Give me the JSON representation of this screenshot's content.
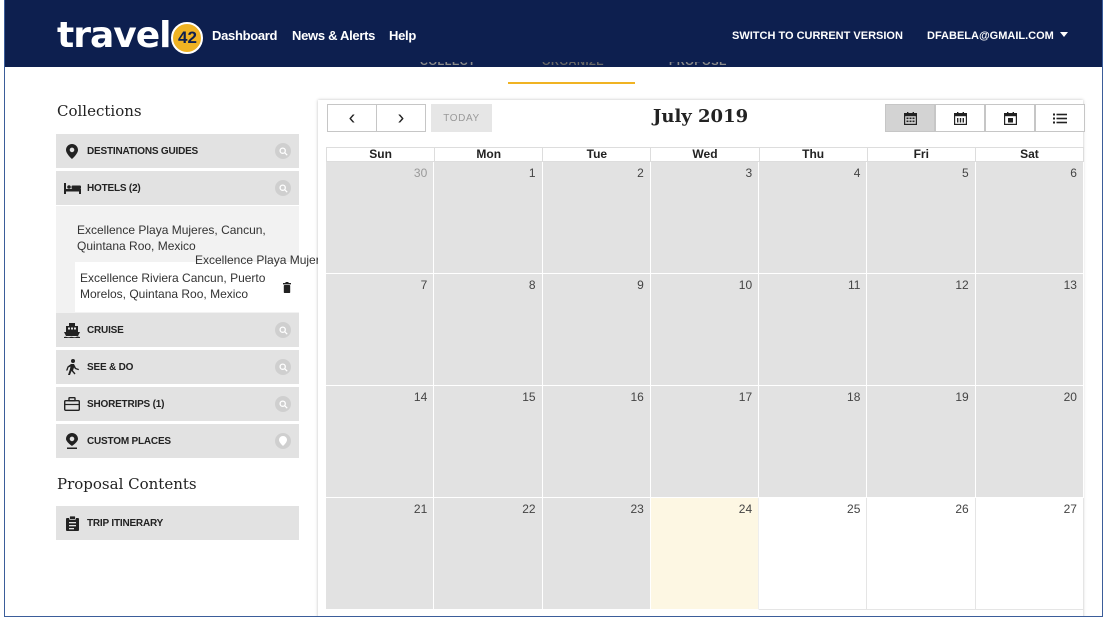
{
  "header": {
    "logo_text": "travel",
    "logo_badge": "42",
    "nav": [
      {
        "label": "Dashboard"
      },
      {
        "label": "News & Alerts"
      },
      {
        "label": "Help"
      }
    ],
    "switch_label": "SWITCH TO CURRENT VERSION",
    "user_email": "DFABELA@GMAIL.COM"
  },
  "steps": [
    {
      "label": "COLLECT"
    },
    {
      "label": "ORGANIZE",
      "active": true
    },
    {
      "label": "PROPOSE"
    }
  ],
  "sidebar": {
    "collections_title": "Collections",
    "items": [
      {
        "label": "DESTINATIONS GUIDES",
        "icon": "map-pin-icon"
      },
      {
        "label": "HOTELS (2)",
        "icon": "bed-icon"
      },
      {
        "label": "CRUISE",
        "icon": "ship-icon"
      },
      {
        "label": "SEE & DO",
        "icon": "walking-person-icon"
      },
      {
        "label": "SHORETRIPS (1)",
        "icon": "suitcase-icon"
      },
      {
        "label": "CUSTOM PLACES",
        "icon": "map-pin-icon"
      }
    ],
    "hotels": [
      {
        "name": "Excellence Playa Mujeres, Cancun, Quintana Roo, Mexico"
      },
      {
        "name": "Excellence Riviera Cancun, Puerto Morelos, Quintana Roo, Mexico"
      }
    ],
    "drag_tooltip": "Excellence Playa Mujeres, Cancun, Quintana Roo, Mexico",
    "proposal_title": "Proposal Contents",
    "proposal_items": [
      {
        "label": "TRIP ITINERARY",
        "icon": "clipboard-icon"
      }
    ]
  },
  "calendar": {
    "title": "July 2019",
    "prev": "‹",
    "next": "›",
    "today_label": "TODAY",
    "views": [
      "month-view-icon",
      "week-view-icon",
      "day-view-icon",
      "list-view-icon"
    ],
    "weekdays": [
      "Sun",
      "Mon",
      "Tue",
      "Wed",
      "Thu",
      "Fri",
      "Sat"
    ],
    "weeks": [
      [
        "30",
        "1",
        "2",
        "3",
        "4",
        "5",
        "6"
      ],
      [
        "7",
        "8",
        "9",
        "10",
        "11",
        "12",
        "13"
      ],
      [
        "14",
        "15",
        "16",
        "17",
        "18",
        "19",
        "20"
      ],
      [
        "21",
        "22",
        "23",
        "24",
        "25",
        "26",
        "27"
      ]
    ],
    "today_date": "24",
    "colors": {
      "past": "#e2e2e2",
      "today": "#fdf7e3",
      "future": "#ffffff",
      "accent": "#f0b323",
      "header": "#0d1f4f"
    }
  }
}
